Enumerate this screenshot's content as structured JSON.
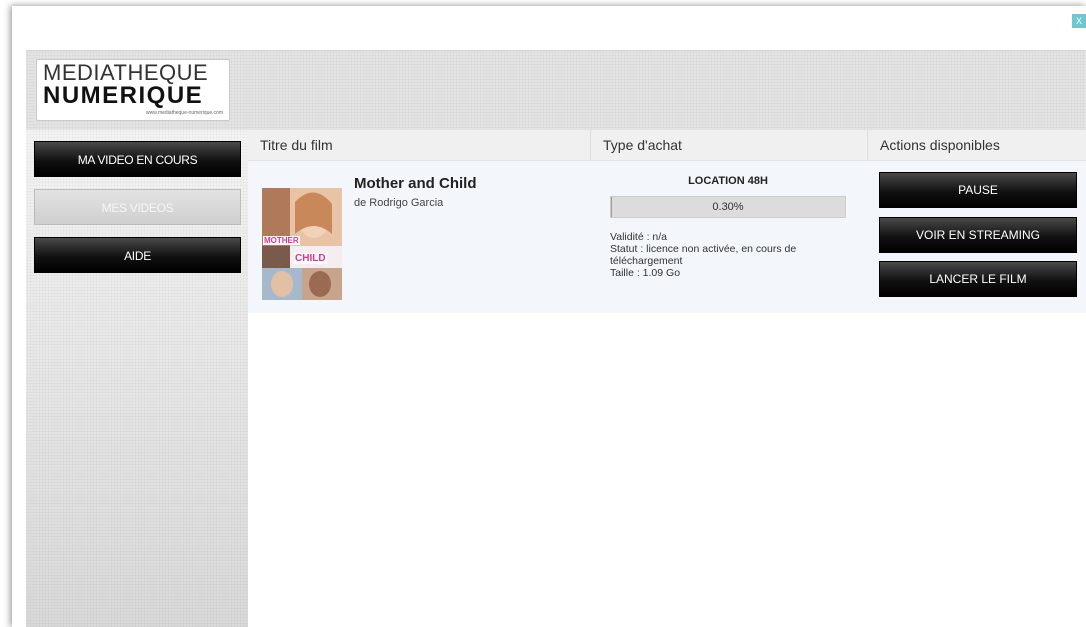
{
  "window": {
    "close_label": "X"
  },
  "header": {
    "logo": {
      "line1": "MEDIATHEQUE",
      "line2": "NUMERIQUE",
      "tagline": "www.mediatheque-numerique.com"
    }
  },
  "sidebar": {
    "items": [
      {
        "label": "MA VIDEO EN COURS",
        "state": "active"
      },
      {
        "label": "MES VIDEOS",
        "state": "disabled"
      },
      {
        "label": "AIDE",
        "state": "active"
      }
    ]
  },
  "table": {
    "headers": [
      "Titre du film",
      "Type d'achat",
      "Actions disponibles"
    ],
    "rows": [
      {
        "poster_text_top": "MOTHER",
        "poster_text_bottom": "CHILD",
        "title": "Mother and Child",
        "director": "de Rodrigo Garcia",
        "purchase_type": "LOCATION 48H",
        "progress_label": "0.30%",
        "progress_percent": 0.3,
        "validity": "Validité : n/a",
        "status": "Statut : licence non activée, en cours de téléchargement",
        "size": "Taille : 1.09 Go",
        "actions": [
          "PAUSE",
          "VOIR EN STREAMING",
          "LANCER LE FILM"
        ]
      }
    ]
  },
  "colors": {
    "button_dark": "#000000",
    "row_bg": "#f3f7fb",
    "close_accent": "#6fc7cf"
  }
}
